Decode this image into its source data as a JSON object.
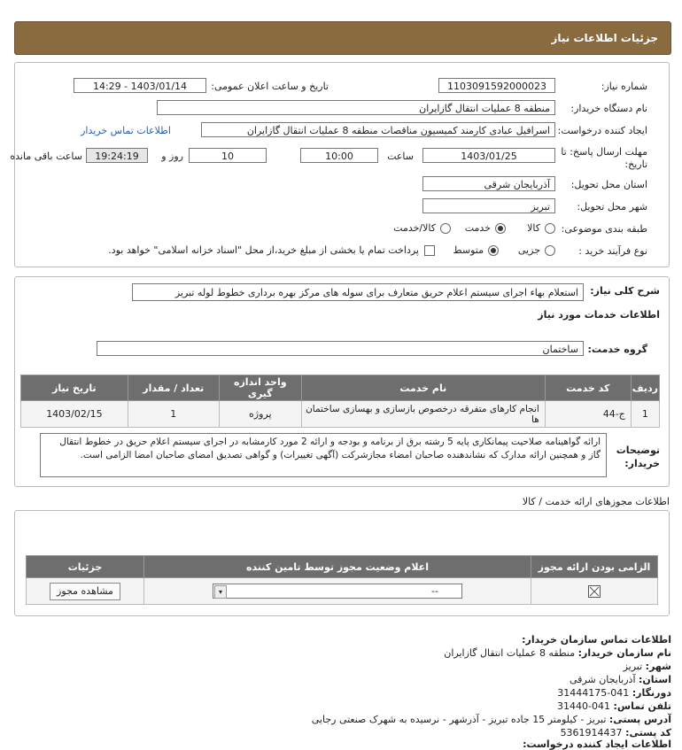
{
  "header": {
    "title": "جزئیات اطلاعات نیاز"
  },
  "form": {
    "need_number_label": "شماره نیاز:",
    "need_number": "1103091592000023",
    "announce_label": "تاریخ و ساعت اعلان عمومی:",
    "announce_value": "1403/01/14 - 14:29",
    "buyer_label": "نام دستگاه خریدار:",
    "buyer_value": "منطقه 8 عملیات انتقال گازایران",
    "creator_label": "ایجاد کننده درخواست:",
    "creator_value": "اسرافیل عبادی کارمند کمیسیون مناقصات منطقه 8 عملیات انتقال گازایران",
    "contact_link": "اطلاعات تماس خریدار",
    "deadline_label_1": "مهلت ارسال پاسخ: تا",
    "deadline_label_2": "تاریخ:",
    "deadline_date": "1403/01/25",
    "time_label": "ساعت",
    "deadline_time": "10:00",
    "days_value": "10",
    "days_label": "روز و",
    "remaining_time": "19:24:19",
    "remaining_label": "ساعت باقی مانده",
    "province_label": "استان محل تحویل:",
    "province_value": "آذربایجان شرقی",
    "city_label": "شهر محل تحویل:",
    "city_value": "تبریز",
    "category_label": "طبقه بندی موضوعی:",
    "cat_goods": "کالا",
    "cat_service": "خدمت",
    "cat_both": "کالا/خدمت",
    "process_label": "نوع فرآیند خرید :",
    "proc_partial": "جزیی",
    "proc_medium": "متوسط",
    "treasury_note": "پرداخت تمام یا بخشی از مبلغ خرید،از محل \"اسناد خزانه اسلامی\" خواهد بود."
  },
  "summary": {
    "label": "شرح کلی نیاز:",
    "value": "استعلام بهاء اجرای سیستم اعلام حریق متعارف برای سوله های مرکز بهره برداری خطوط لوله تبریز",
    "services_title": "اطلاعات خدمات مورد نیاز",
    "group_label": "گروه خدمت:",
    "group_value": "ساختمان"
  },
  "services_table": {
    "headers": [
      "ردیف",
      "کد خدمت",
      "نام خدمت",
      "واحد اندازه گیری",
      "تعداد / مقدار",
      "تاریخ نیاز"
    ],
    "rows": [
      {
        "index": "1",
        "code": "ج-44",
        "name": "انجام کارهای متفرقه درخصوص بازسازی و بهسازی ساختمان ها",
        "unit": "پروژه",
        "qty": "1",
        "date": "1403/02/15"
      }
    ]
  },
  "buyer_notes": {
    "label": "توضیحات خریدار:",
    "text": "ارائه گواهینامه صلاحیت پیمانکاری پایه 5 رشته برق از برنامه و بودجه و ارائه 2 مورد کارمشابه در اجرای سیستم اعلام حریق در خطوط انتقال گاز و همچنین ارائه مدارک که نشاندهنده صاحبان امضاء مجازشرکت (آگهی تغییرات) و گواهی تصدیق امضای صاحبان امضا الزامی است."
  },
  "permits": {
    "title": "اطلاعات مجوزهای ارائه خدمت / کالا",
    "headers": [
      "الزامی بودن ارائه مجوز",
      "اعلام وضعیت مجوز توسط تامین کننده",
      "جزئیات"
    ],
    "select_value": "--",
    "view_button": "مشاهده مجوز"
  },
  "contact": {
    "title": "اطلاعات تماس سازمان خریدار:",
    "org_label": "نام سازمان خریدار:",
    "org_value": "منطقه 8 عملیات انتقال گازایران",
    "city_label": "شهر:",
    "city_value": "تبریز",
    "province_label": "استان:",
    "province_value": "آذربایجان شرقی",
    "fax_label": "دورنگار:",
    "fax_value": "041-31444175",
    "phone_label": "تلفن تماس:",
    "phone_value": "041-31440",
    "address_label": "آدرس پستی:",
    "address_value": "تبریز - کیلومتر 15 جاده تبریز - آذرشهر - نرسیده به شهرک صنعتی رجایی",
    "postal_label": "کد پستی:",
    "postal_value": "5361914437",
    "creator_title": "اطلاعات ایجاد کننده درخواست:"
  }
}
